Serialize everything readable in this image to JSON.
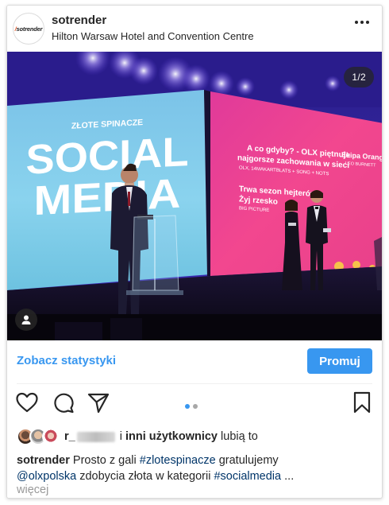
{
  "header": {
    "username": "sotrender",
    "location": "Hilton Warsaw Hotel and Convention Centre",
    "avatar_logo": "sotrender",
    "more_icon": "more-horizontal-icon"
  },
  "media": {
    "counter": "1/2",
    "screen_left": {
      "kicker": "ZŁOTE SPINACZE",
      "line1": "SOCIAL",
      "line2": "MEDIA"
    },
    "screen_right": {
      "title1": "A co gdyby? - OLX piętnuje",
      "title2": "najgorsze zachowania w sieci",
      "sub1": "OLX, 14MAKARTBLATS + SONG + NOTS",
      "side_title": "Ekipa Orange",
      "side_sub": "LEO BURNETT",
      "title3": "Trwa sezon hejterów",
      "title4": "Żyj rzesko",
      "sub2": "BIG PICTURE"
    },
    "tag_icon": "user-tag-icon",
    "carousel_position": 1,
    "carousel_total": 2
  },
  "insights": {
    "link_label": "Zobacz statystyki",
    "promote_label": "Promuj"
  },
  "actions": {
    "like_icon": "heart-icon",
    "comment_icon": "comment-icon",
    "share_icon": "send-icon",
    "save_icon": "bookmark-icon"
  },
  "likes": {
    "liker": "r_",
    "suffix_pre": "i",
    "suffix_bold": "inni użytkownicy",
    "suffix_post": "lubią to"
  },
  "caption": {
    "username": "sotrender",
    "text1": "Prosto z gali",
    "hashtag1": "#zlotespinacze",
    "text2": "gratulujemy",
    "mention": "@olxpolska",
    "text3": "zdobycia złota w kategorii",
    "hashtag2": "#socialmedia",
    "ellipsis": "...",
    "more": "więcej"
  },
  "colors": {
    "accent": "#3897f0",
    "link": "#003569",
    "text": "#262626"
  }
}
